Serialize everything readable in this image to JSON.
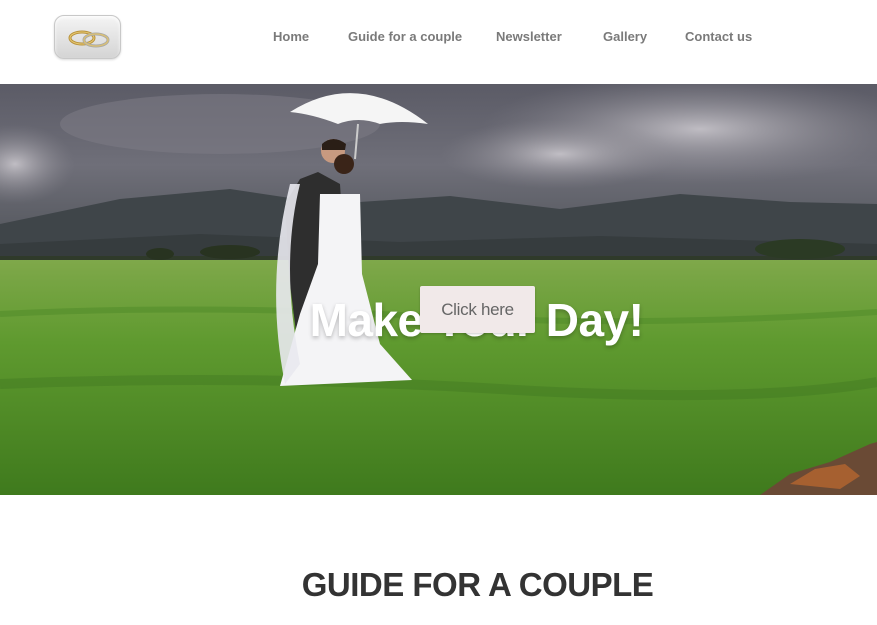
{
  "header": {
    "logo": {
      "icon": "wedding-rings-icon"
    },
    "nav": [
      {
        "label": "Home"
      },
      {
        "label": "Guide for a couple"
      },
      {
        "label": "Newsletter"
      },
      {
        "label": "Gallery"
      },
      {
        "label": "Contact us"
      }
    ]
  },
  "hero": {
    "title": "Make Your Day!",
    "button_label": "Click here"
  },
  "section": {
    "heading": "GUIDE FOR A COUPLE"
  },
  "colors": {
    "nav_text": "#7a7a7a",
    "button_bg": "#f1e9e9",
    "heading_text": "#333333"
  }
}
